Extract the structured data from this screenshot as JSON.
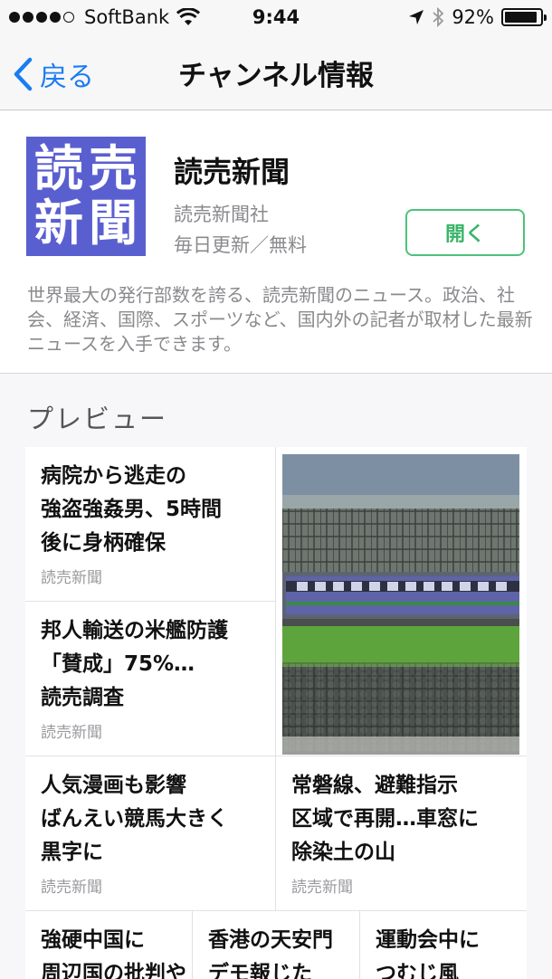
{
  "status_bar": {
    "carrier": "SoftBank",
    "time": "9:44",
    "battery_percent": "92%",
    "battery_level": 0.92
  },
  "nav": {
    "back_label": "戻る",
    "title": "チャンネル情報"
  },
  "channel": {
    "logo_text": [
      "読",
      "売",
      "新",
      "聞"
    ],
    "name": "読売新聞",
    "publisher": "読売新聞社",
    "update_info": "毎日更新／無料",
    "open_button": "開く",
    "description": "世界最大の発行部数を誇る、読売新聞のニュース。政治、社会、経済、国際、スポーツなど、国内外の記者が取材した最新ニュースを入手できます。",
    "accent_color": "#4cc27a",
    "logo_color": "#5a5fd0"
  },
  "preview": {
    "header": "プレビュー",
    "articles": [
      {
        "title": "病院から逃走の\n強盗強姦男、5時間\n後に身柄確保",
        "source": "読売新聞"
      },
      {
        "title": "邦人輸送の米艦防護\n「賛成」75%…\n読売調査",
        "source": "読売新聞"
      },
      {
        "title": "人気漫画も影響\nばんえい競馬大きく\n黒字に",
        "source": "読売新聞"
      },
      {
        "title": "常磐線、避難指示\n区域で再開…車窓に\n除染土の山",
        "source": "読売新聞"
      },
      {
        "title": "強硬中国に\n周辺国の批判や",
        "source": ""
      },
      {
        "title": "香港の天安門\nデモ報じた",
        "source": ""
      },
      {
        "title": "運動会中に\nつむじ風",
        "source": ""
      }
    ]
  }
}
